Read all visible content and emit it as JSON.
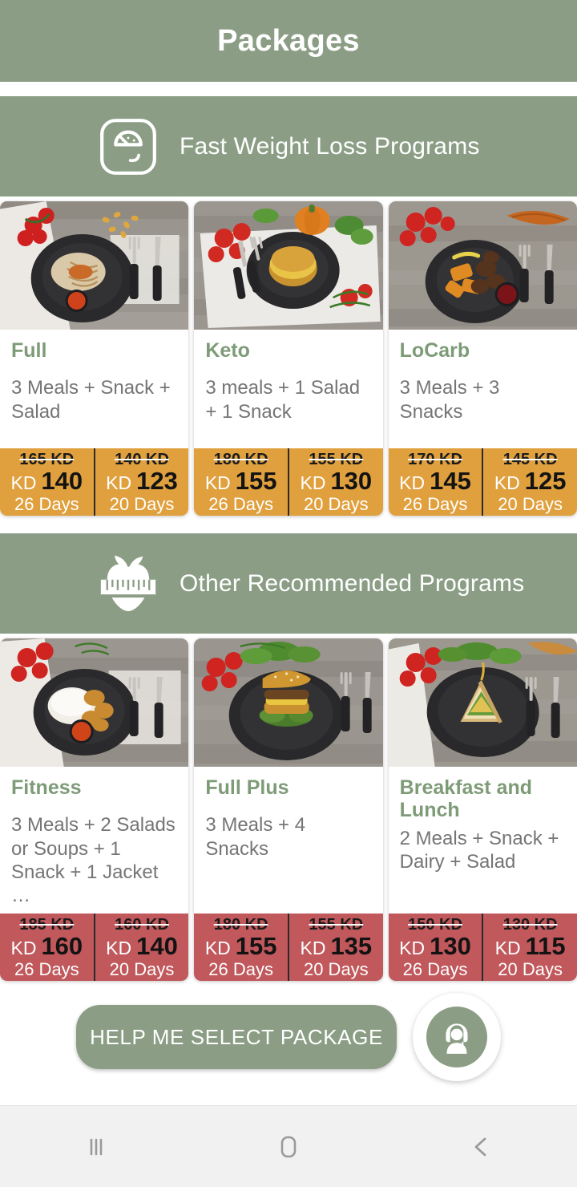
{
  "appbar": {
    "title": "Packages"
  },
  "sections": [
    {
      "id": "fast-weight-loss",
      "title": "Fast Weight Loss Programs",
      "icon": "weight-scale-icon",
      "accent_color": "#e0a03e",
      "cards": [
        {
          "title": "Full",
          "description": "3 Meals + Snack + Salad",
          "image": "pasta-plate-photo",
          "prices": [
            {
              "old": "165 KD",
              "currency": "KD",
              "amount": "140",
              "days": "26  Days"
            },
            {
              "old": "140 KD",
              "currency": "KD",
              "amount": "123",
              "days": "20  Days"
            }
          ]
        },
        {
          "title": "Keto",
          "description": "3 meals + 1 Salad + 1 Snack",
          "image": "burger-plate-photo",
          "prices": [
            {
              "old": "180 KD",
              "currency": "KD",
              "amount": "155",
              "days": "26  Days"
            },
            {
              "old": "155 KD",
              "currency": "KD",
              "amount": "130",
              "days": "20  Days"
            }
          ]
        },
        {
          "title": "LoCarb",
          "description": "3 Meals + 3 Snacks",
          "image": "meat-veg-plate-photo",
          "prices": [
            {
              "old": "170 KD",
              "currency": "KD",
              "amount": "145",
              "days": "26  Days"
            },
            {
              "old": "145 KD",
              "currency": "KD",
              "amount": "125",
              "days": "20  Days"
            }
          ]
        }
      ]
    },
    {
      "id": "other-recommended",
      "title": "Other Recommended Programs",
      "icon": "apple-measuring-tape-icon",
      "accent_color": "#c0585c",
      "cards": [
        {
          "title": "Fitness",
          "description": "3 Meals + 2 Salads or Soups + 1 Snack + 1 Jacket …",
          "image": "chicken-rice-plate-photo",
          "prices": [
            {
              "old": "185 KD",
              "currency": "KD",
              "amount": "160",
              "days": "26  Days"
            },
            {
              "old": "160 KD",
              "currency": "KD",
              "amount": "140",
              "days": "20  Days"
            }
          ]
        },
        {
          "title": "Full Plus",
          "description": "3 Meals + 4 Snacks",
          "image": "cheeseburger-plate-photo",
          "prices": [
            {
              "old": "180 KD",
              "currency": "KD",
              "amount": "155",
              "days": "26  Days"
            },
            {
              "old": "155 KD",
              "currency": "KD",
              "amount": "135",
              "days": "20  Days"
            }
          ]
        },
        {
          "title": "Breakfast and Lunch",
          "description": "2 Meals + Snack + Dairy + Salad",
          "image": "sandwich-plate-photo",
          "prices": [
            {
              "old": "150 KD",
              "currency": "KD",
              "amount": "130",
              "days": "26  Days"
            },
            {
              "old": "130 KD",
              "currency": "KD",
              "amount": "115",
              "days": "20  Days"
            }
          ]
        }
      ]
    }
  ],
  "bottom": {
    "cta_label": "HELP ME SELECT PACKAGE",
    "support_icon": "headset-support-icon"
  },
  "navbar": {
    "recents_icon": "recents-icon",
    "home_icon": "home-icon",
    "back_icon": "back-icon"
  },
  "colors": {
    "brand_green": "#8b9e85",
    "orange_price": "#e0a03e",
    "red_price": "#c0585c",
    "title_green": "#7e9b78",
    "description_gray": "#757575"
  }
}
